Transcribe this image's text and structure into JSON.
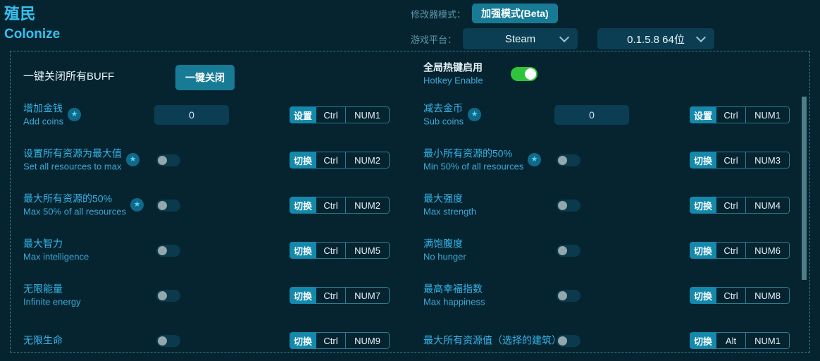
{
  "header": {
    "title_cn": "殖民",
    "title_en": "Colonize",
    "mode_label": "修改器模式：",
    "mode_button": "加强模式(Beta)",
    "platform_label": "游戏平台：",
    "platform_value": "Steam",
    "version_value": "0.1.5.8 64位"
  },
  "top": {
    "close_all_label": "一键关闭所有BUFF",
    "close_all_button": "一键关闭",
    "hotkey_enable_cn": "全局热键启用",
    "hotkey_enable_en": "Hotkey Enable",
    "hotkey_enable_state": "on"
  },
  "colors": {
    "background": "#062430",
    "accent": "#35b5e8",
    "button": "#177b96",
    "hotkey_action": "#1489ab",
    "toggle_on": "#2fc53b",
    "panel_border": "#2f7d93"
  },
  "rows": [
    {
      "col": "left",
      "index": 0,
      "cn": "增加金钱",
      "en": "Add coins",
      "star": true,
      "control": "input",
      "value": "0",
      "action": "设置",
      "mod": "Ctrl",
      "key": "NUM1"
    },
    {
      "col": "right",
      "index": 0,
      "cn": "减去金币",
      "en": "Sub coins",
      "star": true,
      "control": "input",
      "value": "0",
      "action": "设置",
      "mod": "Ctrl",
      "key": "NUM1"
    },
    {
      "col": "left",
      "index": 1,
      "cn": "设置所有资源为最大值",
      "en": "Set all resources to max",
      "star": true,
      "control": "toggle",
      "state": "off",
      "action": "切换",
      "mod": "Ctrl",
      "key": "NUM2"
    },
    {
      "col": "right",
      "index": 1,
      "cn": "最小所有资源的50%",
      "en": "Min 50% of all resources",
      "star": true,
      "control": "toggle",
      "state": "off",
      "action": "切换",
      "mod": "Ctrl",
      "key": "NUM3"
    },
    {
      "col": "left",
      "index": 2,
      "cn": "最大所有资源的50%",
      "en": "Max 50% of all resources",
      "star": true,
      "control": "toggle",
      "state": "off",
      "action": "切换",
      "mod": "Ctrl",
      "key": "NUM2"
    },
    {
      "col": "right",
      "index": 2,
      "cn": "最大强度",
      "en": "Max strength",
      "star": false,
      "control": "toggle",
      "state": "off",
      "action": "切换",
      "mod": "Ctrl",
      "key": "NUM4"
    },
    {
      "col": "left",
      "index": 3,
      "cn": "最大智力",
      "en": "Max intelligence",
      "star": false,
      "control": "toggle",
      "state": "off",
      "action": "切换",
      "mod": "Ctrl",
      "key": "NUM5"
    },
    {
      "col": "right",
      "index": 3,
      "cn": "满饱腹度",
      "en": "No hunger",
      "star": false,
      "control": "toggle",
      "state": "off",
      "action": "切换",
      "mod": "Ctrl",
      "key": "NUM6"
    },
    {
      "col": "left",
      "index": 4,
      "cn": "无限能量",
      "en": "Infinite energy",
      "star": false,
      "control": "toggle",
      "state": "off",
      "action": "切换",
      "mod": "Ctrl",
      "key": "NUM7"
    },
    {
      "col": "right",
      "index": 4,
      "cn": "最高幸福指数",
      "en": "Max happiness",
      "star": false,
      "control": "toggle",
      "state": "off",
      "action": "切换",
      "mod": "Ctrl",
      "key": "NUM8"
    },
    {
      "col": "left",
      "index": 5,
      "cn": "无限生命",
      "en": "",
      "star": false,
      "control": "toggle",
      "state": "off",
      "action": "切换",
      "mod": "Ctrl",
      "key": "NUM9"
    },
    {
      "col": "right",
      "index": 5,
      "cn": "最大所有资源值（选择的建筑）",
      "en": "",
      "star": false,
      "control": "toggle",
      "state": "off",
      "action": "切换",
      "mod": "Alt",
      "key": "NUM1",
      "wrap": true
    }
  ]
}
